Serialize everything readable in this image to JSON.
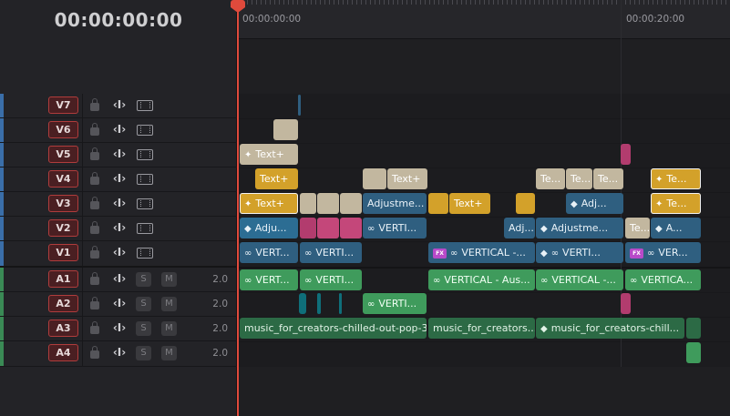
{
  "timecode": "00:00:00:00",
  "ruler": {
    "labels": [
      "00:00:00:00",
      "00:00:20:00"
    ]
  },
  "tracks": {
    "video": [
      {
        "id": "V7"
      },
      {
        "id": "V6"
      },
      {
        "id": "V5"
      },
      {
        "id": "V4"
      },
      {
        "id": "V3"
      },
      {
        "id": "V2"
      },
      {
        "id": "V1"
      }
    ],
    "audio": [
      {
        "id": "A1",
        "solo": "S",
        "mute": "M",
        "channels": "2.0"
      },
      {
        "id": "A2",
        "solo": "S",
        "mute": "M",
        "channels": "2.0"
      },
      {
        "id": "A3",
        "solo": "S",
        "mute": "M",
        "channels": "2.0"
      },
      {
        "id": "A4",
        "solo": "S",
        "mute": "M",
        "channels": "2.0"
      }
    ]
  },
  "icons": {
    "lock": "lock-icon",
    "auto_select": "auto-select-icon",
    "film": "film-strip-icon",
    "link": "link-icon",
    "text_plus": "sparkle-icon",
    "adjustment": "diamond-icon",
    "fx": "fx-badge-icon",
    "auto_select_glyph": "‹I›"
  },
  "clips": {
    "v5_text": "Text+",
    "v4_text1": "Text+",
    "v4_text2": "Text+",
    "v4_te1": "Te...",
    "v4_te2": "Te...",
    "v4_te3": "Te...",
    "v4_te4": "Te...",
    "v3_text1": "Text+",
    "v3_adjust": "Adjustme...",
    "v3_text2": "Text+",
    "v3_adj": "Adj...",
    "v3_te": "Te...",
    "v2_adju": "Adju...",
    "v2_verti": "VERTI...",
    "v2_adj": "Adj...",
    "v2_adjustme": "Adjustme...",
    "v2_te": "Te...",
    "v2_a": "A...",
    "v1_vert": "VERT...",
    "v1_verti": "VERTI...",
    "v1_vertical": "VERTICAL -...",
    "v1_verti2": "VERTI...",
    "v1_ver": "VER...",
    "fx_label": "FX",
    "a1_vert": "VERT...",
    "a1_verti": "VERTI...",
    "a1_vertical_aus": "VERTICAL - Aus...",
    "a1_vertical2": "VERTICAL -...",
    "a1_vertica": "VERTICA...",
    "a2_verti": "VERTI...",
    "a3_music1": "music_for_creators-chilled-out-pop-3...",
    "a3_music2": "music_for_creators...",
    "a3_music3": "music_for_creators-chill..."
  },
  "colors": {
    "playhead": "#e04a3c",
    "text_clip": "#c2b79f",
    "title_clip": "#d3a12a",
    "video_clip": "#2c6d93",
    "audio_clip": "#3f9b5c",
    "music_clip": "#2c6a45",
    "pink_clip": "#c4477a",
    "track_badge_border": "#b03c3c"
  }
}
